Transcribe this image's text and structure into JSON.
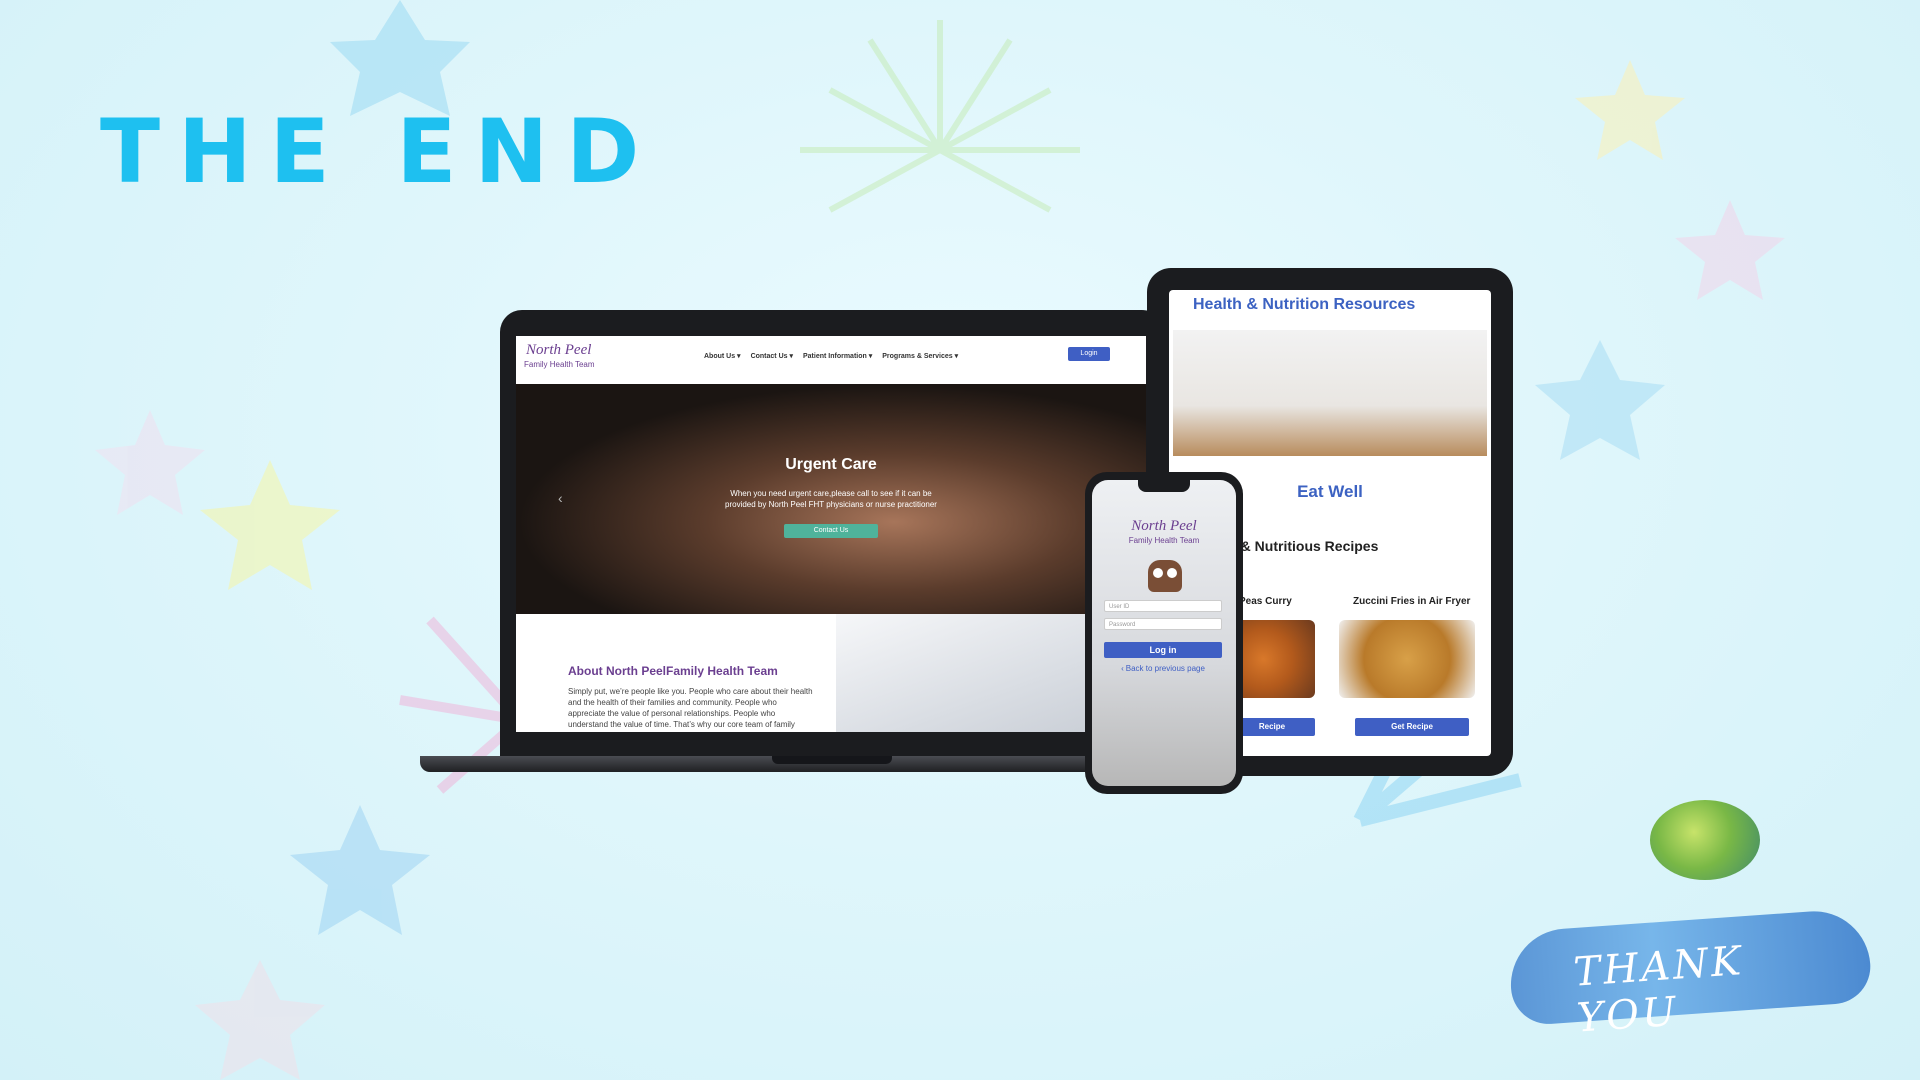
{
  "slide": {
    "title": "THE END",
    "thank_you": "THANK YOU"
  },
  "laptop": {
    "logo_line1": "North Peel",
    "logo_line2": "Family Health Team",
    "nav": [
      "About Us ▾",
      "Contact Us ▾",
      "Patient Information ▾",
      "Programs & Services ▾"
    ],
    "login": "Login",
    "hero": {
      "title": "Urgent Care",
      "text": "When you need urgent care,please call to see if it can be provided by North Peel FHT physicians or nurse practitioner",
      "button": "Contact Us"
    },
    "about": {
      "title": "About North PeelFamily Health Team",
      "text": "Simply put, we’re people like you. People who care about their health and the health of their families and community. People who appreciate the value of personal relationships. People who understand the value of time. That’s why our core team of family"
    }
  },
  "tablet": {
    "heading": "Health & Nutrition Resources",
    "section": "Eat Well",
    "subheading": "y & Nutritious Recipes",
    "recipe1": "Peas Curry",
    "recipe2": "Zuccini Fries in Air Fryer",
    "btn1": "Recipe",
    "btn2": "Get Recipe"
  },
  "phone": {
    "logo_line1": "North Peel",
    "logo_line2": "Family Health Team",
    "user_placeholder": "User ID",
    "password_placeholder": "Password",
    "login": "Log in",
    "back": "Back to previous page"
  },
  "colors": {
    "accent": "#1ec0f0",
    "brand_purple": "#6b3f90",
    "button_blue": "#3f5fc4",
    "hero_button": "#4fb39b"
  }
}
